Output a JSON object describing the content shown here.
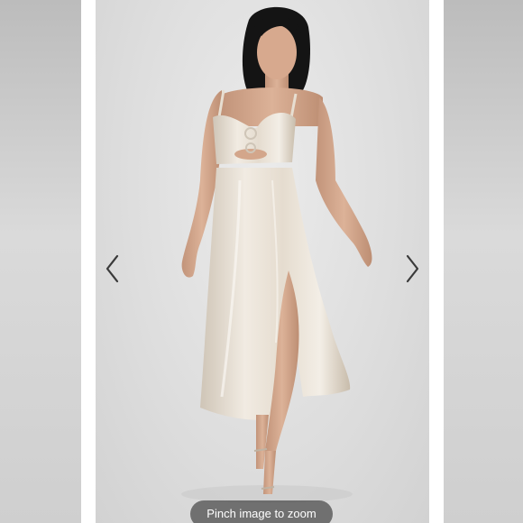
{
  "viewer": {
    "zoom_hint": "Pinch image to zoom",
    "prev_icon": "chevron-left-icon",
    "next_icon": "chevron-right-icon"
  },
  "colors": {
    "page_background": "#ffffff",
    "photo_background": "#e3e3e3",
    "dress": "#e8dfd2",
    "hair": "#141414",
    "skin": "#d3a68b",
    "arrow": "#3a3a3a",
    "pill": "#464646"
  }
}
